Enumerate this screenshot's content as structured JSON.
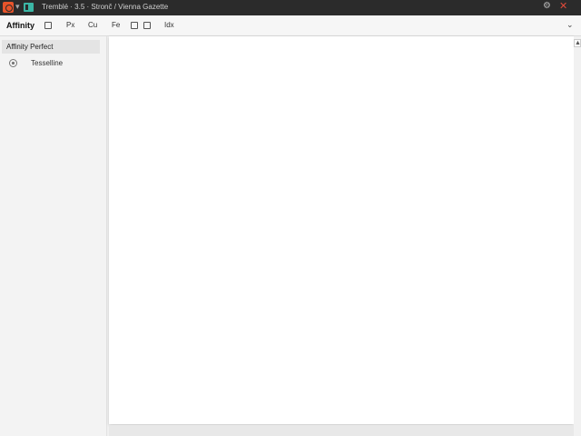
{
  "window": {
    "title": "Tremblé · 3.5 · Stronč / Vienna Gazette",
    "icons": {
      "logo": "affinity-logo-icon",
      "studio": "studio-icon",
      "settings": "gear-icon",
      "close": "close-icon"
    }
  },
  "toolbar": {
    "brand": "Affinity",
    "items": [
      "Px",
      "Cu",
      "Fe",
      "Idx"
    ]
  },
  "sidebar": {
    "header": "Affinity Perfect",
    "items": [
      {
        "label": "Tesselline",
        "icon": "document-icon"
      }
    ]
  },
  "colors": {
    "titlebar": "#2b2b2b",
    "logo": "#e8542a",
    "studio": "#3bb6a5",
    "close": "#e04a3a"
  }
}
